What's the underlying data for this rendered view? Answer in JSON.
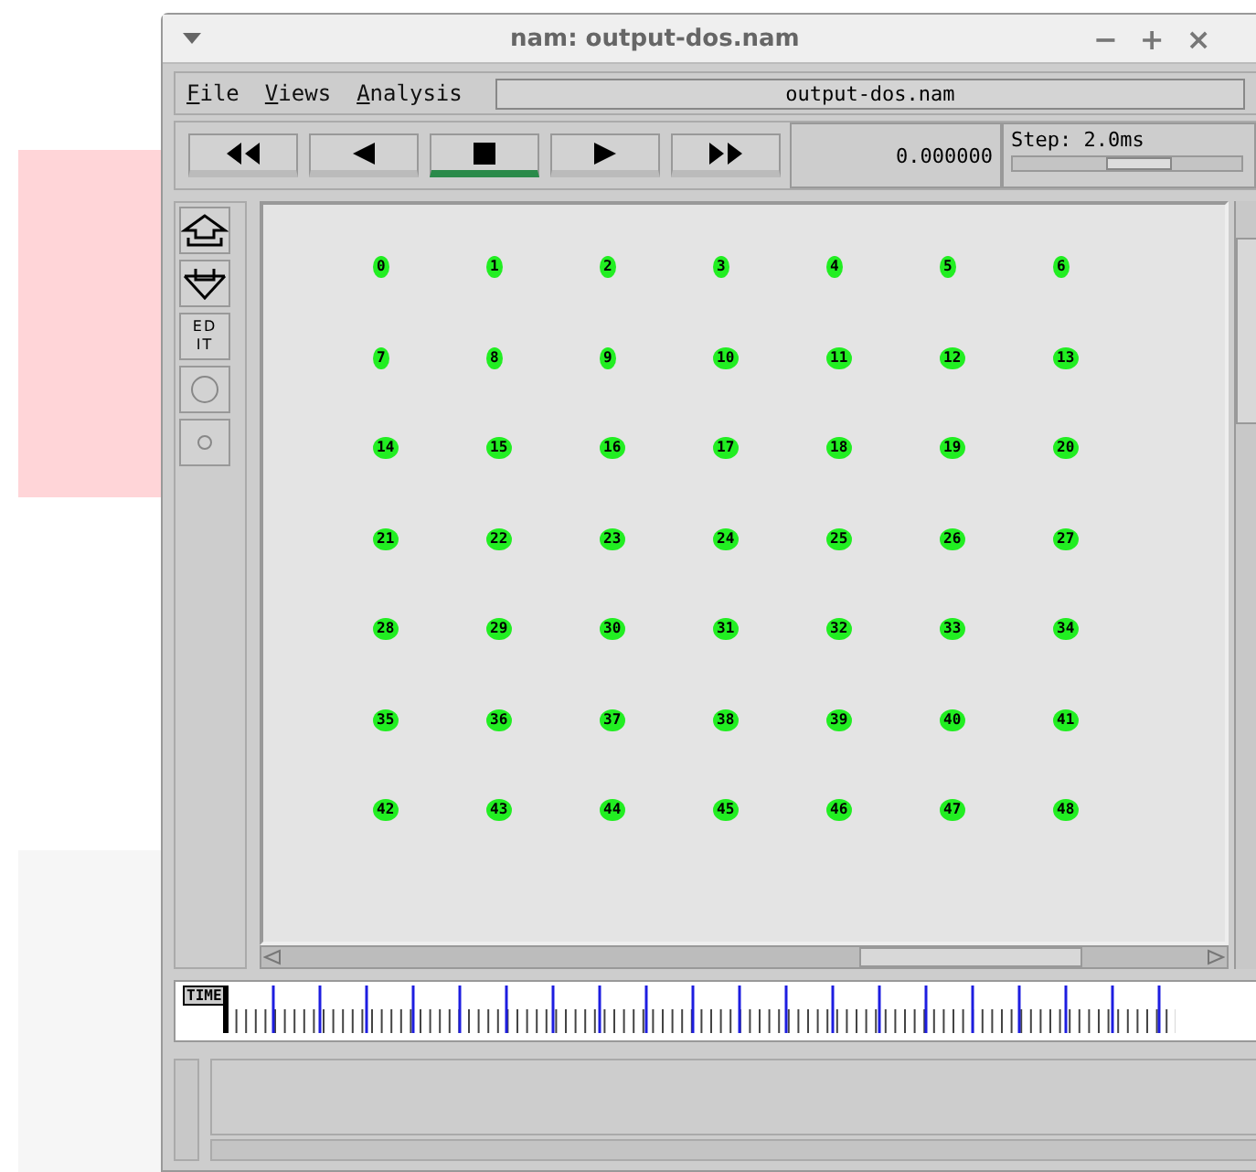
{
  "window": {
    "title": "nam: output-dos.nam",
    "controls": [
      "−",
      "+",
      "×"
    ]
  },
  "menu": [
    {
      "label": "File"
    },
    {
      "label": "Views"
    },
    {
      "label": "Analysis"
    }
  ],
  "file_field": {
    "value": "output-dos.nam"
  },
  "transport": [
    {
      "kind": "rewind",
      "selected": false
    },
    {
      "kind": "back",
      "selected": false
    },
    {
      "kind": "stop",
      "selected": true
    },
    {
      "kind": "play",
      "selected": false
    },
    {
      "kind": "forward",
      "selected": false
    }
  ],
  "time_readout": "0.000000",
  "step": {
    "label": "Step: 2.0ms",
    "level": 0.55
  },
  "tools": [
    {
      "kind": "zoom-in"
    },
    {
      "kind": "zoom-out"
    },
    {
      "kind": "edit",
      "label": "EDIT"
    },
    {
      "kind": "big-circle"
    },
    {
      "kind": "small-circle"
    }
  ],
  "nodes": [
    "0",
    "1",
    "2",
    "3",
    "4",
    "5",
    "6",
    "7",
    "8",
    "9",
    "10",
    "11",
    "12",
    "13",
    "14",
    "15",
    "16",
    "17",
    "18",
    "19",
    "20",
    "21",
    "22",
    "23",
    "24",
    "25",
    "26",
    "27",
    "28",
    "29",
    "30",
    "31",
    "32",
    "33",
    "34",
    "35",
    "36",
    "37",
    "38",
    "39",
    "40",
    "41",
    "42",
    "43",
    "44",
    "45",
    "46",
    "47",
    "48"
  ],
  "timeline": {
    "label": "TIME",
    "level": 0
  }
}
